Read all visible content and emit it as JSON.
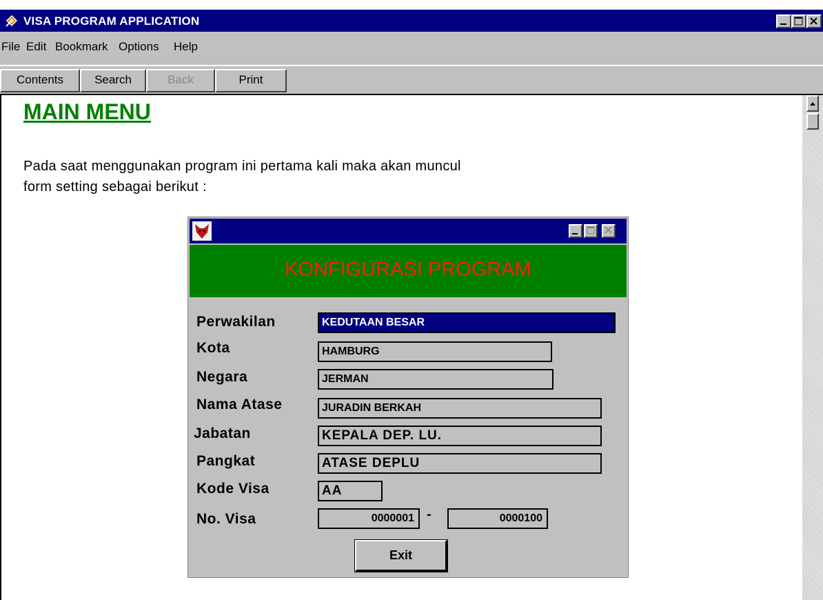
{
  "window": {
    "title": "VISA PROGRAM APPLICATION",
    "controls": [
      "minimize",
      "maximize",
      "close"
    ]
  },
  "menu": [
    {
      "label": "File"
    },
    {
      "label": "Edit"
    },
    {
      "label": "Bookmark"
    },
    {
      "label": "Options"
    },
    {
      "label": "Help"
    }
  ],
  "toolbar": [
    {
      "label": "Contents",
      "enabled": true
    },
    {
      "label": "Search",
      "enabled": true
    },
    {
      "label": "Back",
      "enabled": false
    },
    {
      "label": "Print",
      "enabled": true
    }
  ],
  "content": {
    "heading": "MAIN MENU",
    "intro_line1": "Pada saat menggunakan program ini pertama kali maka akan muncul",
    "intro_line2": "form setting sebagai berikut :"
  },
  "dialog": {
    "banner_title": "KONFIGURASI PROGRAM",
    "fields": [
      {
        "label": "Perwakilan",
        "value": "KEDUTAAN BESAR"
      },
      {
        "label": "Kota",
        "value": "HAMBURG"
      },
      {
        "label": "Negara",
        "value": "JERMAN"
      },
      {
        "label": "Nama Atase",
        "value": "JURADIN BERKAH"
      },
      {
        "label": "Jabatan",
        "value": "KEPALA DEP. LU."
      },
      {
        "label": "Pangkat",
        "value": "ATASE DEPLU"
      },
      {
        "label": "Kode Visa",
        "value": "AA"
      }
    ],
    "visa_no": {
      "label": "No. Visa",
      "from": "0000001",
      "separator": "-",
      "to": "0000100"
    },
    "exit_label": "Exit"
  },
  "colors": {
    "title_bar": "#000080",
    "heading": "#008000",
    "banner": "#008000",
    "banner_text": "#ff1a1a",
    "face": "#c0c0c0"
  }
}
